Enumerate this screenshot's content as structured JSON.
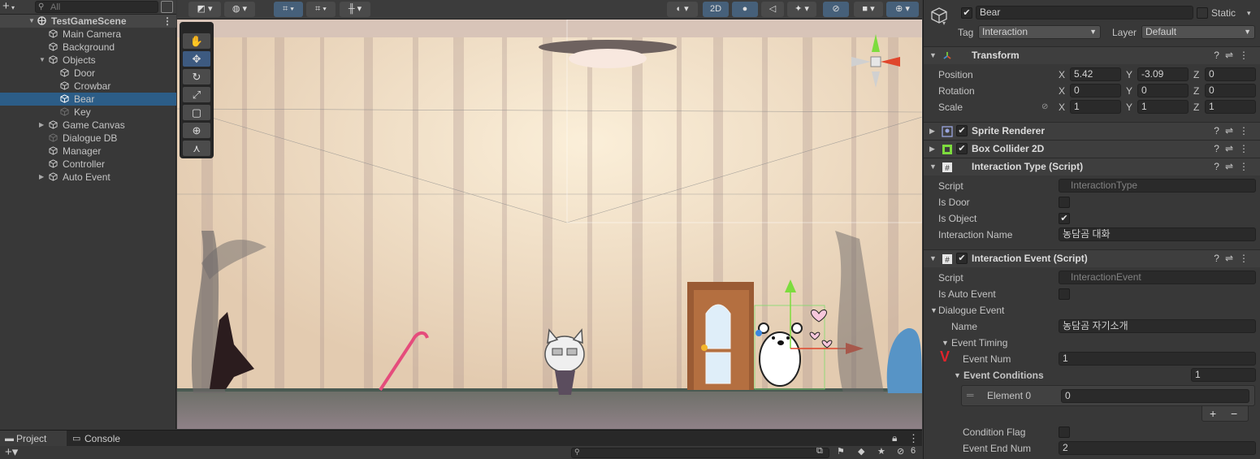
{
  "hierarchy": {
    "add_label": "+",
    "search_placeholder": "All",
    "scene_name": "TestGameScene",
    "items": [
      {
        "label": "Main Camera"
      },
      {
        "label": "Background"
      },
      {
        "label": "Objects"
      },
      {
        "label": "Door"
      },
      {
        "label": "Crowbar"
      },
      {
        "label": "Bear"
      },
      {
        "label": "Key"
      },
      {
        "label": "Game Canvas"
      },
      {
        "label": "Dialogue DB"
      },
      {
        "label": "Manager"
      },
      {
        "label": "Controller"
      },
      {
        "label": "Auto Event"
      }
    ]
  },
  "scene_toolbar": {
    "mode_2d": "2D"
  },
  "bottom": {
    "tabs": [
      {
        "label": "Project"
      },
      {
        "label": "Console"
      }
    ],
    "hidden_count": "6"
  },
  "inspector": {
    "object_name": "Bear",
    "static_label": "Static",
    "tag_label": "Tag",
    "tag_value": "Interaction",
    "layer_label": "Layer",
    "layer_value": "Default",
    "transform": {
      "title": "Transform",
      "position_label": "Position",
      "rotation_label": "Rotation",
      "scale_label": "Scale",
      "position": {
        "x": "5.42",
        "y": "-3.09",
        "z": "0"
      },
      "rotation": {
        "x": "0",
        "y": "0",
        "z": "0"
      },
      "scale": {
        "x": "1",
        "y": "1",
        "z": "1"
      },
      "axis_x": "X",
      "axis_y": "Y",
      "axis_z": "Z"
    },
    "sprite_renderer": {
      "title": "Sprite Renderer"
    },
    "box_collider": {
      "title": "Box Collider 2D"
    },
    "interaction_type": {
      "title": "Interaction Type (Script)",
      "script_label": "Script",
      "script_value": "InteractionType",
      "is_door_label": "Is Door",
      "is_object_label": "Is Object",
      "is_object_check": "✔",
      "name_label": "Interaction Name",
      "name_value": "농담곰 대화"
    },
    "interaction_event": {
      "title": "Interaction Event (Script)",
      "script_label": "Script",
      "script_value": "InteractionEvent",
      "is_auto_label": "Is Auto Event",
      "dialogue_event_label": "Dialogue Event",
      "name_label": "Name",
      "name_value": "농담곰 자기소개",
      "event_timing_label": "Event Timing",
      "event_num_label": "Event Num",
      "event_num_value": "1",
      "event_conditions_label": "Event Conditions",
      "event_conditions_count": "1",
      "element0_label": "Element 0",
      "element0_value": "0",
      "condition_flag_label": "Condition Flag",
      "event_end_label": "Event End Num",
      "event_end_value": "2",
      "plus_label": "+",
      "minus_label": "−"
    }
  }
}
